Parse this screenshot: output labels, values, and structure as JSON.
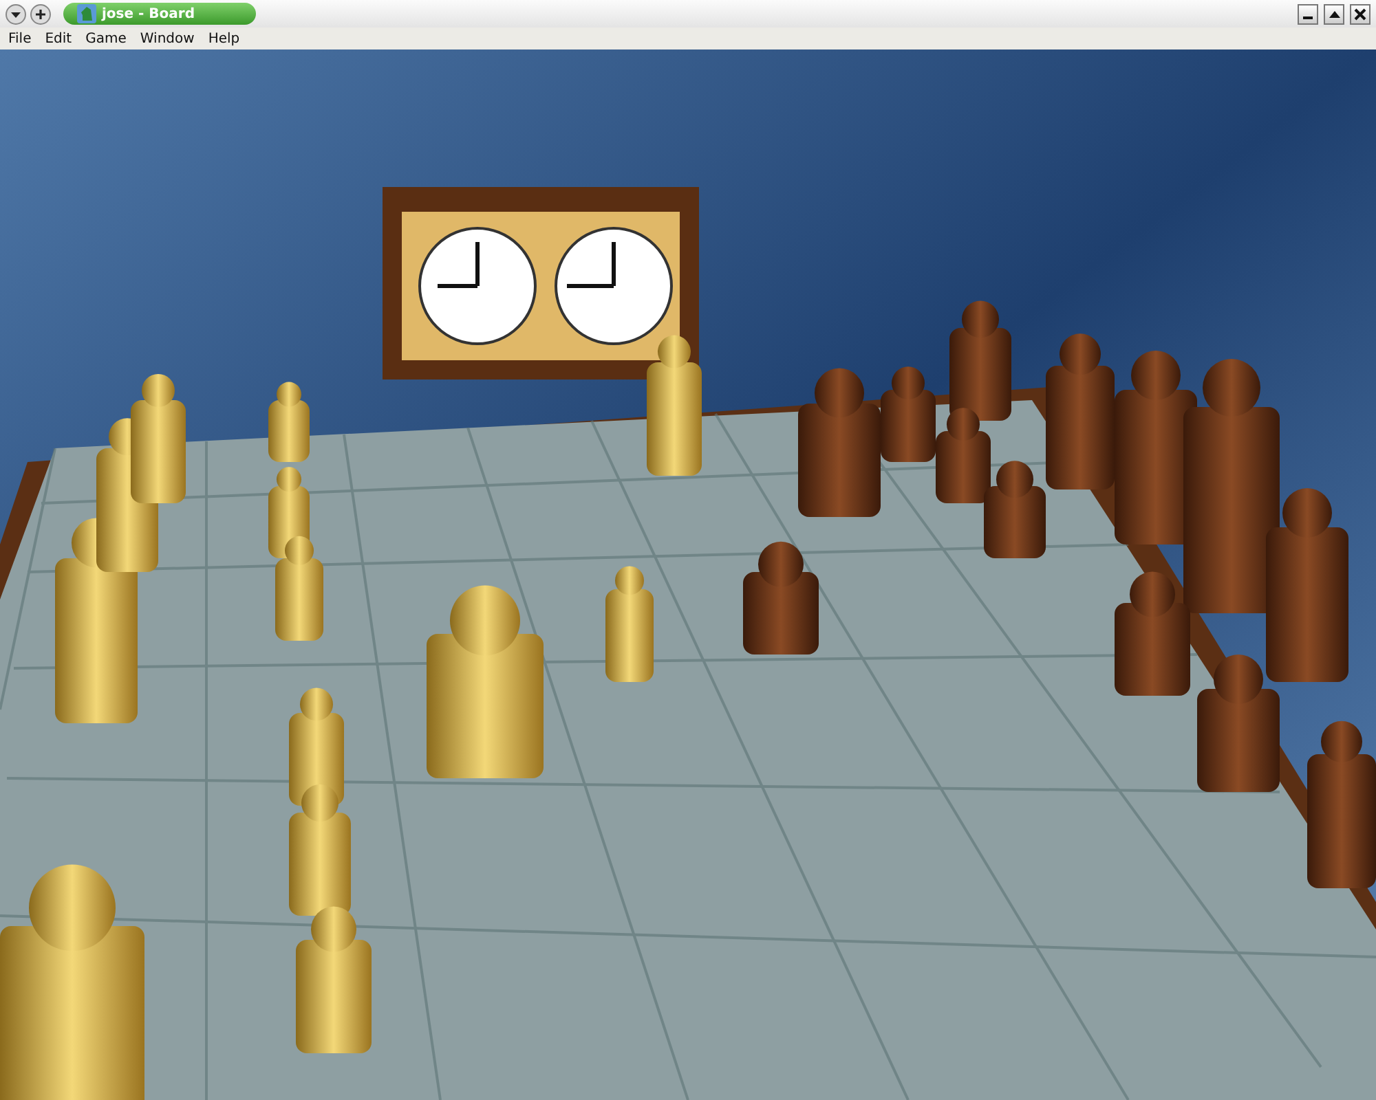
{
  "window": {
    "title": "jose - Board"
  },
  "menu": [
    "File",
    "Edit",
    "Game",
    "Window",
    "Help"
  ]
}
